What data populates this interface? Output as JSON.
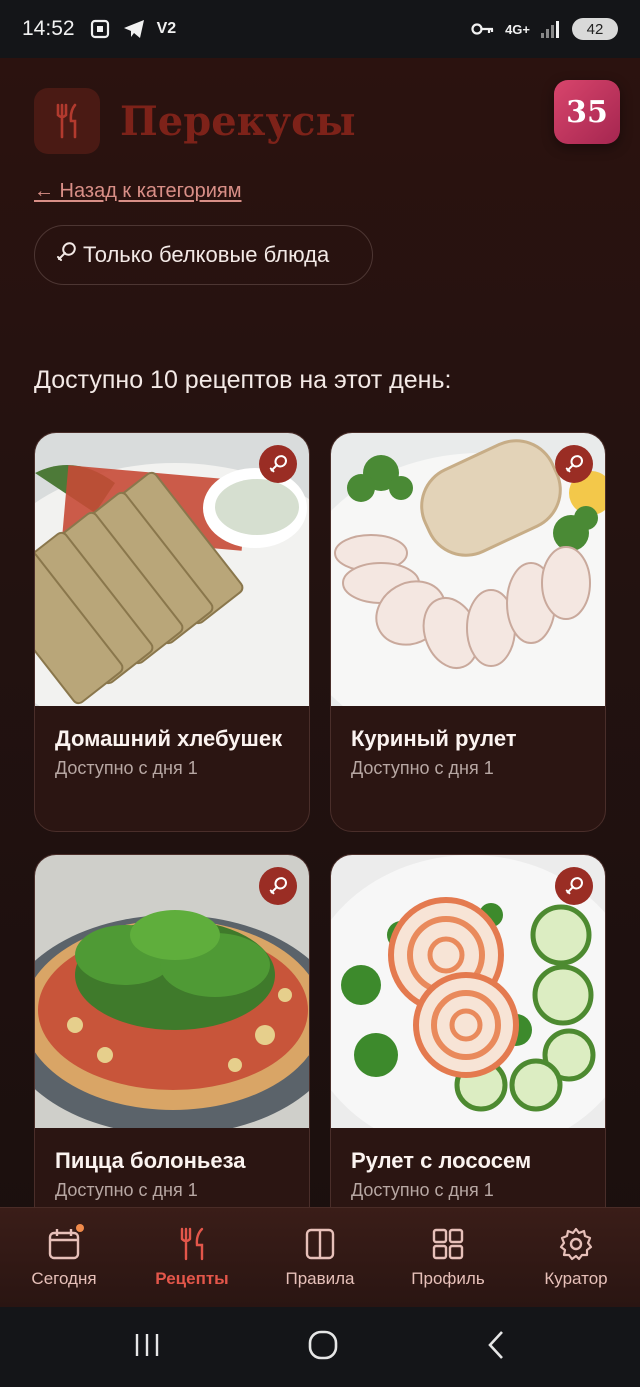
{
  "status_bar": {
    "time": "14:52",
    "left_icons": [
      "screenshot-icon",
      "telegram-icon",
      "v2-icon"
    ],
    "v2_label": "V2",
    "network": "4G+",
    "battery": "42"
  },
  "header": {
    "title": "Перекусы",
    "day_badge": "35",
    "logo_icon": "utensils-icon"
  },
  "back_link": "← Назад к категориям",
  "filter": {
    "icon": "drumstick-icon",
    "label": "Только белковые блюда"
  },
  "recipes_count_text": "Доступно 10 рецептов на этот день:",
  "recipes": [
    {
      "name": "Домашний хлебушек",
      "availability": "Доступно с дня 1",
      "badge_icon": "drumstick-icon"
    },
    {
      "name": "Куриный рулет",
      "availability": "Доступно с дня 1",
      "badge_icon": "drumstick-icon"
    },
    {
      "name": "Пицца болоньеза",
      "availability": "Доступно с дня 1",
      "badge_icon": "drumstick-icon"
    },
    {
      "name": "Рулет с лососем",
      "availability": "Доступно с дня 1",
      "badge_icon": "drumstick-icon"
    }
  ],
  "bottom_nav": [
    {
      "label": "Сегодня",
      "icon": "calendar-icon",
      "active": false,
      "has_dot": true
    },
    {
      "label": "Рецепты",
      "icon": "utensils-icon",
      "active": true,
      "has_dot": false
    },
    {
      "label": "Правила",
      "icon": "book-icon",
      "active": false,
      "has_dot": false
    },
    {
      "label": "Профиль",
      "icon": "grid-icon",
      "active": false,
      "has_dot": false
    },
    {
      "label": "Куратор",
      "icon": "gear-icon",
      "active": false,
      "has_dot": false
    }
  ],
  "colors": {
    "accent": "#e3564a",
    "title": "#7d2219",
    "badge": "#c23a60",
    "background": "#1a0f0e"
  }
}
